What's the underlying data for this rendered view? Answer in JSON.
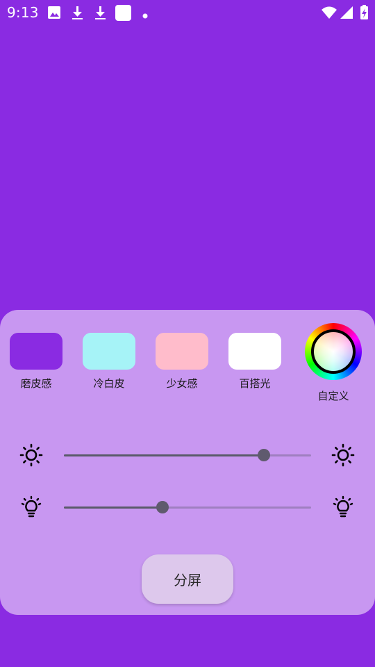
{
  "status_bar": {
    "time": "9:13",
    "icons": [
      "image-icon",
      "download-icon",
      "download-icon",
      "square-icon",
      "dot-icon",
      "wifi-icon",
      "cellular-icon",
      "battery-charging-icon"
    ]
  },
  "presets": [
    {
      "label": "磨皮感",
      "color": "#8A2BE2"
    },
    {
      "label": "冷白皮",
      "color": "#A6F3F7"
    },
    {
      "label": "少女感",
      "color": "#FFBCCB"
    },
    {
      "label": "百搭光",
      "color": "#FFFFFF"
    }
  ],
  "custom": {
    "label": "自定义"
  },
  "sliders": {
    "brightness": {
      "value": 0.81,
      "icon": "brightness-icon"
    },
    "color_temperature": {
      "value": 0.4,
      "icon": "lightbulb-icon"
    }
  },
  "split_button": {
    "label": "分屏"
  },
  "colors": {
    "background": "#8A2BE2",
    "panel": "#C897F1",
    "button": "#DDC8EC"
  }
}
